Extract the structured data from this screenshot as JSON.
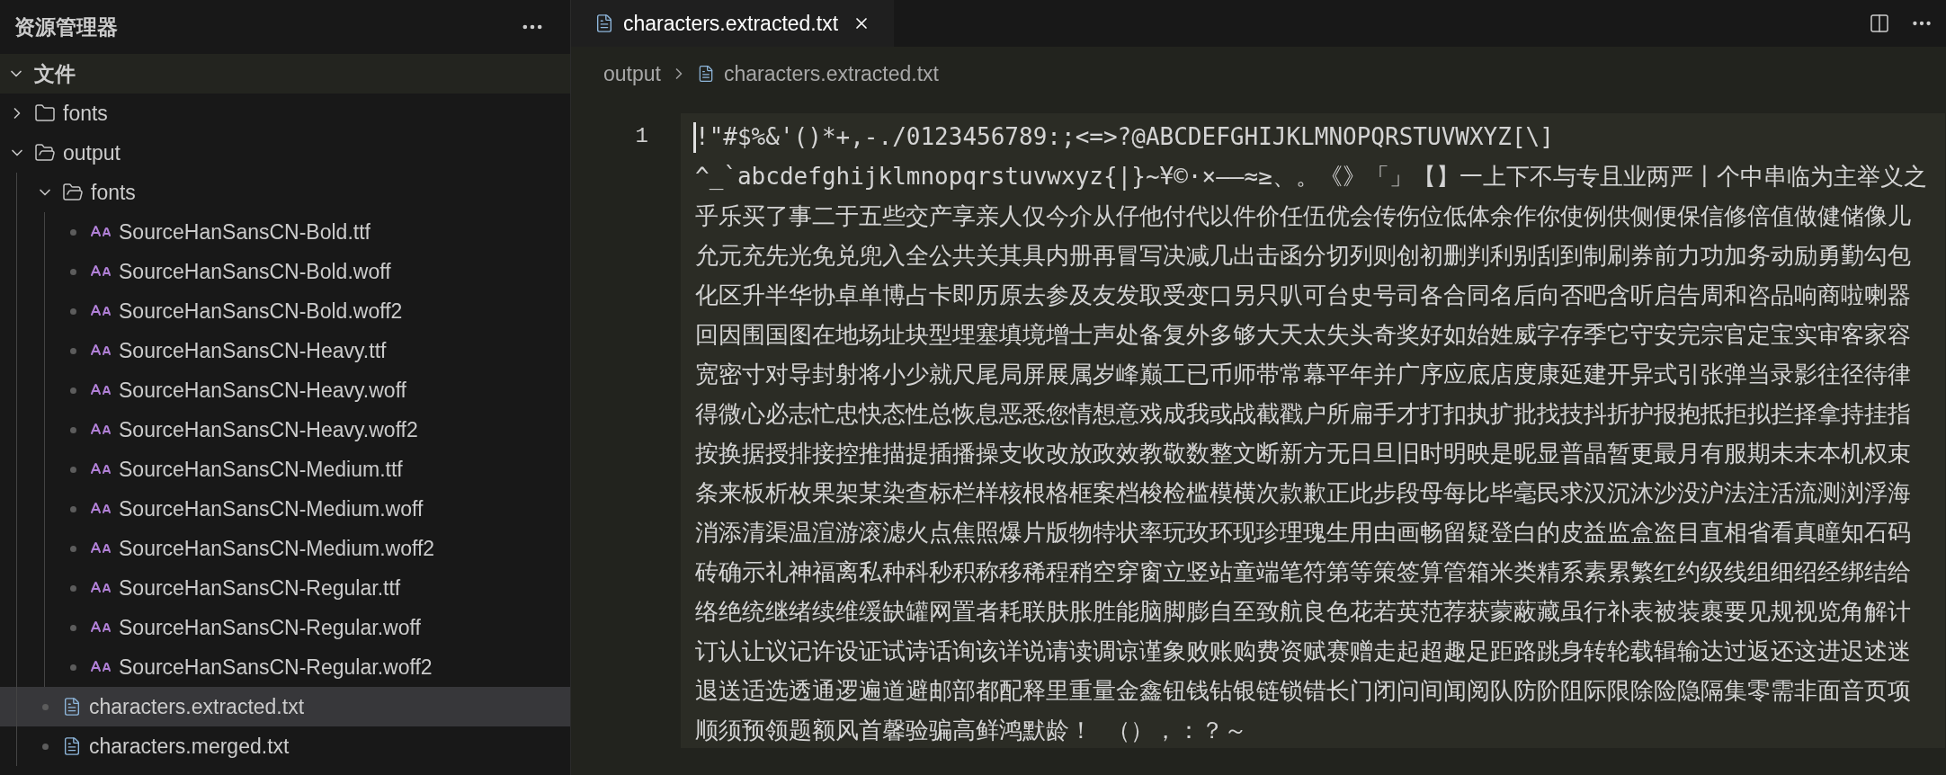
{
  "sidebar": {
    "title": "资源管理器",
    "section": {
      "label": "文件",
      "expanded": true
    },
    "tree": [
      {
        "name": "fonts",
        "kind": "folder",
        "expanded": false,
        "selected": false
      },
      {
        "name": "output",
        "kind": "folder",
        "expanded": true,
        "selected": false,
        "children": [
          {
            "name": "fonts",
            "kind": "folder",
            "expanded": true,
            "selected": false,
            "children": [
              {
                "name": "SourceHanSansCN-Bold.ttf",
                "kind": "font",
                "selected": false
              },
              {
                "name": "SourceHanSansCN-Bold.woff",
                "kind": "font",
                "selected": false
              },
              {
                "name": "SourceHanSansCN-Bold.woff2",
                "kind": "font",
                "selected": false
              },
              {
                "name": "SourceHanSansCN-Heavy.ttf",
                "kind": "font",
                "selected": false
              },
              {
                "name": "SourceHanSansCN-Heavy.woff",
                "kind": "font",
                "selected": false
              },
              {
                "name": "SourceHanSansCN-Heavy.woff2",
                "kind": "font",
                "selected": false
              },
              {
                "name": "SourceHanSansCN-Medium.ttf",
                "kind": "font",
                "selected": false
              },
              {
                "name": "SourceHanSansCN-Medium.woff",
                "kind": "font",
                "selected": false
              },
              {
                "name": "SourceHanSansCN-Medium.woff2",
                "kind": "font",
                "selected": false
              },
              {
                "name": "SourceHanSansCN-Regular.ttf",
                "kind": "font",
                "selected": false
              },
              {
                "name": "SourceHanSansCN-Regular.woff",
                "kind": "font",
                "selected": false
              },
              {
                "name": "SourceHanSansCN-Regular.woff2",
                "kind": "font",
                "selected": false
              }
            ]
          },
          {
            "name": "characters.extracted.txt",
            "kind": "text",
            "selected": true
          },
          {
            "name": "characters.merged.txt",
            "kind": "text",
            "selected": false
          }
        ]
      }
    ]
  },
  "editor": {
    "tabs": [
      {
        "label": "characters.extracted.txt",
        "selected": true
      }
    ],
    "breadcrumb": [
      "output",
      "characters.extracted.txt"
    ],
    "line_number": "1",
    "wrapped_lines": [
      "!\"#$%&'()*+,-./0123456789:;<=>?@ABCDEFGHIJKLMNOPQRSTUVWXYZ[\\]",
      "^_`abcdefghijklmnopqrstuvwxyz{|}~¥©·×–—≈≥、。《》「」【】一上下不与专且业两严丨个中串临为主举义之",
      "乎乐买了事二于五些交产享亲人仅今介从仔他付代以件价任伍优会传伤位低体余作你使例供侧便保信修倍值做健储像儿",
      "允元充先光免兑兜入全公共关其具内册再冒写决减几出击函分切列则创初删判利别刮到制刷券前力功加务动励勇勤勾包",
      "化区升半华协卓单博占卡即历原去参及友发取受变口另只叭可台史号司各合同名后向否吧含听启告周和咨品响商啦喇器",
      "回因围国图在地场址块型埋塞填境增士声处备复外多够大天太失头奇奖好如始姓威字存季它守安完宗官定宝实审客家容",
      "宽密寸对导封射将小少就尺尾局屏展属岁峰巅工已币师带常幕平年并广序应底店度康延建开异式引张弹当录影往径待律",
      "得微心必志忙忠快态性总恢息恶悉您情想意戏成我或战截戳户所扁手才打扣执扩批找技抖折护报抱抵拒拟拦择拿持挂指",
      "按换据授排接控推描提插播操支收改放政效教敬数整文断新方无日旦旧时明映是昵显普晶暂更最月有服期未末本机权束",
      "条来板析枚果架某染查标栏样核根格框案档梭检槛模横次款歉正此步段母每比毕毫民求汉沉沐沙没沪法注活流测浏浮海",
      "消添清渠温渲游滚滤火点焦照爆片版物特状率玩玫环现珍理瑰生用由画畅留疑登白的皮益监盒盗目直相省看真瞳知石码",
      "砖确示礼神福离私种科秒积称移稀程稍空穿窗立竖站童端笔符第等策签算管箱米类精系素累繁红约级线组细绍经绑结给",
      "络绝统继绪续维缓缺罐网置者耗联肤胀胜能脑脚膨自至致航良色花若英范荐获蒙蔽藏虽行补表被装裹要见规视览角解计",
      "订认让议记许设证试诗话询该详说请读调谅谨象败账购费资赋赛赠走起超趣足距路跳身转轮载辑输达过返还这进迟述迷",
      "退送适选透通逻遍道避邮部都配释里重量金鑫钮钱钻银链锁错长门闭问间闻阅队防阶阻际限除险隐隔集零需非面音页项",
      "顺须预领题额风首馨验骗高鲜鸿默龄！ （），：？～"
    ]
  }
}
